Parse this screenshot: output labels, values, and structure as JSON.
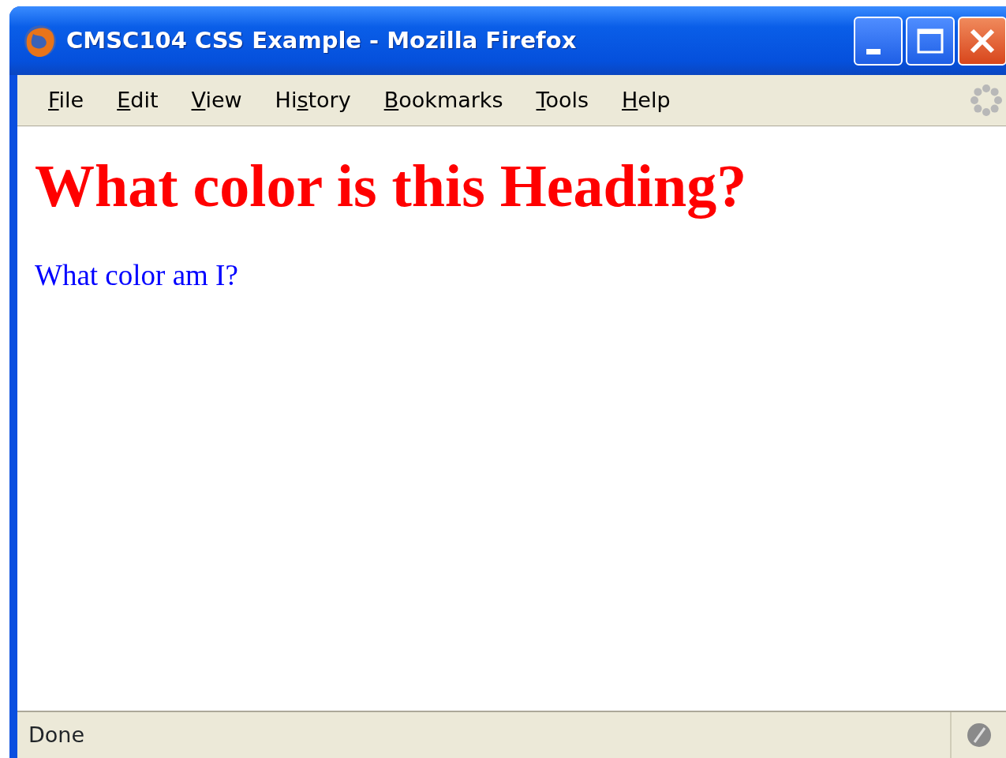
{
  "window": {
    "title": "CMSC104 CSS Example - Mozilla Firefox"
  },
  "menu": [
    {
      "accesskey": "F",
      "label_rest": "ile"
    },
    {
      "accesskey": "E",
      "label_rest": "dit"
    },
    {
      "accesskey": "V",
      "label_rest": "iew"
    },
    {
      "label_start": "Hi",
      "accesskey": "s",
      "label_rest": "tory"
    },
    {
      "accesskey": "B",
      "label_rest": "ookmarks"
    },
    {
      "accesskey": "T",
      "label_rest": "ools"
    },
    {
      "accesskey": "H",
      "label_rest": "elp"
    }
  ],
  "page": {
    "heading": "What color is this Heading?",
    "paragraph": "What color am I?"
  },
  "status_bar": {
    "text": "Done"
  }
}
